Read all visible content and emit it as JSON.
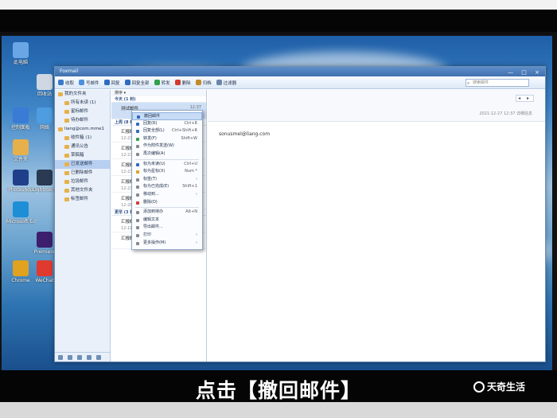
{
  "window": {
    "title": "Foxmail",
    "controls": "— □ ×"
  },
  "toolbar": {
    "buttons": [
      {
        "label": "收取",
        "icon": "receive-icon",
        "color": "#3b79c9"
      },
      {
        "label": "写邮件",
        "icon": "compose-icon",
        "color": "#4b8fdf"
      },
      {
        "label": "回复",
        "icon": "reply-icon",
        "color": "#2d6bc0"
      },
      {
        "label": "回复全部",
        "icon": "reply-all-icon",
        "color": "#2d6bc0"
      },
      {
        "label": "转发",
        "icon": "forward-icon",
        "color": "#2fa14a"
      },
      {
        "label": "删除",
        "icon": "delete-icon",
        "color": "#d33b2f"
      },
      {
        "label": "归档",
        "icon": "archive-icon",
        "color": "#c28a2a"
      },
      {
        "label": "过滤器",
        "icon": "filter-icon",
        "color": "#6b86a8"
      }
    ],
    "search_placeholder": "搜索邮件"
  },
  "sidebar": {
    "items": [
      {
        "label": "我的文件夹",
        "type": "header"
      },
      {
        "label": "所有未读 (1)",
        "type": "sub"
      },
      {
        "label": "星标邮件",
        "type": "sub"
      },
      {
        "label": "待办邮件",
        "type": "sub"
      },
      {
        "label": "liang@com.mme1",
        "type": "header"
      },
      {
        "label": "收件箱 (1)",
        "type": "sub"
      },
      {
        "label": "通讯公告",
        "type": "sub"
      },
      {
        "label": "草稿箱",
        "type": "sub"
      },
      {
        "label": "已发送邮件",
        "type": "sub",
        "selected": true
      },
      {
        "label": "已删除邮件",
        "type": "sub"
      },
      {
        "label": "垃圾邮件",
        "type": "sub"
      },
      {
        "label": "其他文件夹",
        "type": "sub"
      },
      {
        "label": "标签邮件",
        "type": "sub"
      }
    ]
  },
  "list": {
    "header": "排序 ▾",
    "groups": [
      {
        "label": "今天 (1 封)",
        "items": [
          {
            "subject": "测试邮件",
            "date": "12:37",
            "preview": ""
          }
        ]
      },
      {
        "label": "上周 (8 封)",
        "items": [
          {
            "subject": "汇报邮件",
            "date": "12-23",
            "preview": "12-23 点击 无标题 内容"
          },
          {
            "subject": "汇报邮件",
            "date": "12-23",
            "preview": "12-23 点击 无标题 内容"
          },
          {
            "subject": "汇报邮件",
            "date": "12-23",
            "preview": "12-23 点击 无标题 内容"
          },
          {
            "subject": "汇报邮件",
            "date": "12-23",
            "preview": "12-23 点击 无标题 内容"
          },
          {
            "subject": "汇报邮件",
            "date": "12-20",
            "preview": "12-20 点击 无标题 内容"
          }
        ]
      },
      {
        "label": "更早 (3 封)",
        "items": [
          {
            "subject": "汇报邮件",
            "date": "12-18",
            "preview": "12-18 点击 无标题 内容"
          },
          {
            "subject": "汇报邮件",
            "date": "12-18",
            "preview": ""
          }
        ]
      }
    ]
  },
  "reader": {
    "date": "2021-12-27 12:37 详细信息",
    "email": "sonusmel@liang.com",
    "nav": "◂ ▸"
  },
  "context_menu": {
    "items": [
      {
        "label": "撤回邮件",
        "key": "",
        "hover": true,
        "color": "#2d6bc0"
      },
      {
        "label": "回复(R)",
        "key": "Ctrl+R",
        "color": "#2d6bc0"
      },
      {
        "label": "回复全部(L)",
        "key": "Ctrl+Shift+R",
        "color": "#2d6bc0"
      },
      {
        "label": "转发(F)",
        "key": "Shift+W",
        "color": "#2fa14a"
      },
      {
        "label": "作为附件发送(W)",
        "key": "",
        "color": "#888"
      },
      {
        "label": "再次编辑(A)",
        "key": "",
        "color": "#888"
      },
      {
        "sep": true
      },
      {
        "label": "标为未读(U)",
        "key": "Ctrl+U",
        "color": "#2d6bc0"
      },
      {
        "label": "标为星标(X)",
        "key": "Num *",
        "color": "#e0a21f"
      },
      {
        "label": "标签(T)",
        "key": "›",
        "color": "#888"
      },
      {
        "label": "标为已完成(E)",
        "key": "Shift+1",
        "color": "#888"
      },
      {
        "label": "移动到...",
        "key": "›",
        "color": "#888"
      },
      {
        "label": "删除(D)",
        "key": "",
        "color": "#d33b2f"
      },
      {
        "sep": true
      },
      {
        "label": "添加到待办",
        "key": "Alt+N",
        "color": "#888"
      },
      {
        "label": "编辑文本",
        "key": "",
        "color": "#888"
      },
      {
        "label": "导出邮件...",
        "key": "",
        "color": "#888"
      },
      {
        "label": "打印",
        "key": "›",
        "color": "#888"
      },
      {
        "label": "更多操作(M)",
        "key": "›",
        "color": "#888"
      }
    ]
  },
  "desktop_icons": [
    {
      "label": "此电脑",
      "color": "#6aa6e6"
    },
    {
      "label": "回收站",
      "color": "#cfd8e2"
    },
    {
      "label": "控制面板",
      "color": "#3a7bd5"
    },
    {
      "label": "网络",
      "color": "#4d9de0"
    },
    {
      "label": "文件夹",
      "color": "#e8b04a"
    },
    {
      "label": "Photoshop",
      "color": "#1f3f8a"
    },
    {
      "label": "Lightroom",
      "color": "#2a3a52"
    },
    {
      "label": "Microsoft Edge",
      "color": "#1e8fd6"
    },
    {
      "label": "Premiere",
      "color": "#3d1f6e"
    },
    {
      "label": "Chrome",
      "color": "#e0a21f"
    },
    {
      "label": "WeChat",
      "color": "#e03a2f"
    }
  ],
  "caption": {
    "text": "点击【撤回邮件】",
    "brand": "天奇生活"
  }
}
